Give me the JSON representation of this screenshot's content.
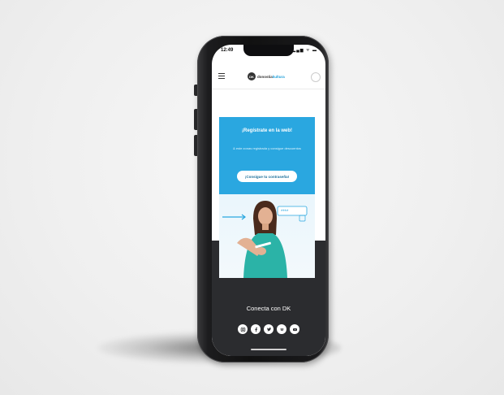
{
  "status_bar": {
    "time": "12:49",
    "icons": "▂▄▆ ᯤ ▬"
  },
  "header": {
    "logo_mark": "DK",
    "logo_text_prefix": "donostia",
    "logo_text_accent": "kultura"
  },
  "promo": {
    "title": "¡Regístrate en la web!",
    "text": "& este zonas registrada y consigue descuentos",
    "button_label": "¡Consigue tu contraseña!",
    "password_mask": "****"
  },
  "footer": {
    "social_title": "Conecta con DK",
    "social_icons": [
      "instagram-icon",
      "facebook-icon",
      "twitter-icon",
      "spotify-icon",
      "youtube-icon"
    ]
  },
  "colors": {
    "accent": "#2aa7e0",
    "footer_bg": "#2b2c2f",
    "shirt": "#2bb3a7"
  }
}
